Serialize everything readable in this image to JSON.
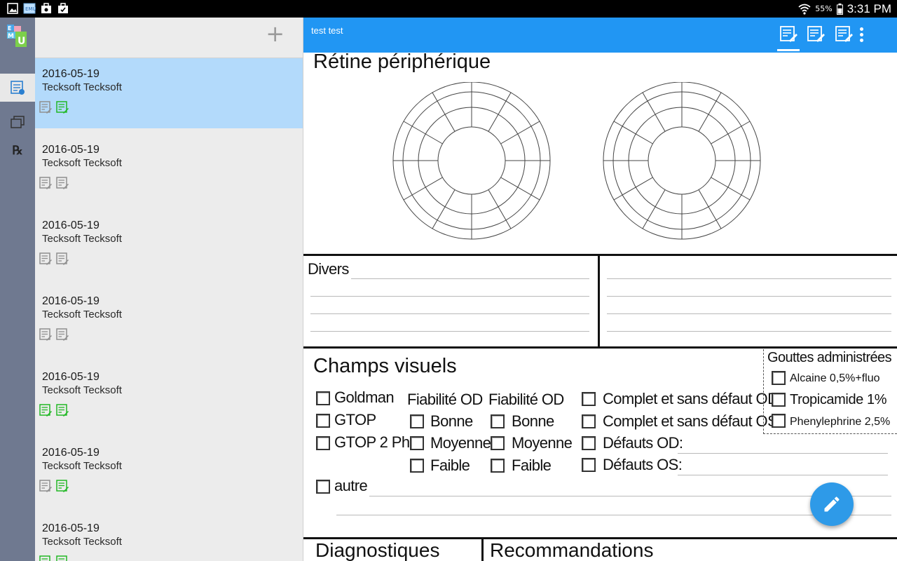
{
  "status_bar": {
    "battery": "55%",
    "time": "3:31 PM"
  },
  "rail": {
    "items": [
      {
        "icon": "records-icon",
        "active": true
      },
      {
        "icon": "gallery-icon",
        "active": false
      },
      {
        "icon": "prescription-icon",
        "label": "℞",
        "active": false
      }
    ]
  },
  "list": {
    "add_label": "+",
    "items": [
      {
        "date": "2016-05-19",
        "name": "Tecksoft Tecksoft",
        "icons": [
          "grey",
          "green"
        ],
        "selected": true
      },
      {
        "date": "2016-05-19",
        "name": "Tecksoft Tecksoft",
        "icons": [
          "grey",
          "grey"
        ],
        "selected": false
      },
      {
        "date": "2016-05-19",
        "name": "Tecksoft Tecksoft",
        "icons": [
          "grey",
          "grey"
        ],
        "selected": false
      },
      {
        "date": "2016-05-19",
        "name": "Tecksoft Tecksoft",
        "icons": [
          "grey",
          "grey"
        ],
        "selected": false
      },
      {
        "date": "2016-05-19",
        "name": "Tecksoft Tecksoft",
        "icons": [
          "green",
          "green"
        ],
        "selected": false
      },
      {
        "date": "2016-05-19",
        "name": "Tecksoft Tecksoft",
        "icons": [
          "grey",
          "green"
        ],
        "selected": false
      },
      {
        "date": "2016-05-19",
        "name": "Tecksoft Tecksoft",
        "icons": [
          "green",
          "green"
        ],
        "selected": false
      }
    ]
  },
  "toolbar": {
    "title": "test test",
    "color": "#2196f3"
  },
  "form": {
    "retina_title": "Rétine périphérique",
    "divers_label": "Divers",
    "visual_fields_title": "Champs visuels",
    "goldman": "Goldman",
    "gtop": "GTOP",
    "gtop2": "GTOP 2 Ph.",
    "autre": "autre",
    "reliability_od_1": "Fiabilité OD",
    "reliability_od_2": "Fiabilité OD",
    "bonne_1": "Bonne",
    "moyenne_1": "Moyenne",
    "faible_1": "Faible",
    "bonne_2": "Bonne",
    "moyenne_2": "Moyenne",
    "faible_2": "Faible",
    "complete_od": "Complet et sans défaut OD",
    "complete_os": "Complet et sans défaut OS",
    "defects_od": "Défauts OD:",
    "defects_os": "Défauts OS:",
    "drops_title": "Gouttes administrées",
    "drop_alcaine": "Alcaine 0,5%+fluo",
    "drop_tropicamide": "Tropicamide 1%",
    "drop_phenylephrine": "Phenylephrine 2,5%",
    "diagnostics_title": "Diagnostiques",
    "recommendations_title": "Recommandations"
  },
  "colors": {
    "accent": "#2196f3",
    "selected_row": "#b3dafb",
    "rail": "#6f7990",
    "green_icon": "#21b825",
    "fab": "#2e9ae8"
  }
}
